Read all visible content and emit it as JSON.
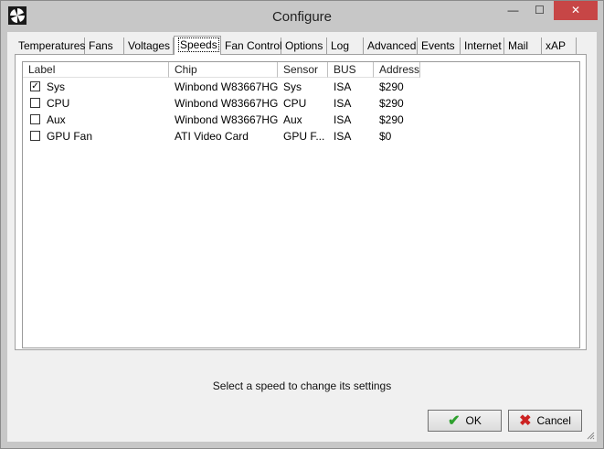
{
  "window": {
    "title": "Configure",
    "controls": {
      "minimize": "—",
      "maximize": "☐",
      "close": "✕"
    }
  },
  "tabs": [
    {
      "label": "Temperatures",
      "active": false
    },
    {
      "label": "Fans",
      "active": false
    },
    {
      "label": "Voltages",
      "active": false
    },
    {
      "label": "Speeds",
      "active": true
    },
    {
      "label": "Fan Control",
      "active": false
    },
    {
      "label": "Options",
      "active": false
    },
    {
      "label": "Log",
      "active": false
    },
    {
      "label": "Advanced",
      "active": false
    },
    {
      "label": "Events",
      "active": false
    },
    {
      "label": "Internet",
      "active": false
    },
    {
      "label": "Mail",
      "active": false
    },
    {
      "label": "xAP",
      "active": false
    }
  ],
  "list": {
    "columns": [
      "Label",
      "Chip",
      "Sensor",
      "BUS",
      "Address"
    ],
    "rows": [
      {
        "checked": true,
        "label": "Sys",
        "chip": "Winbond W83667HG",
        "sensor": "Sys",
        "bus": "ISA",
        "address": "$290"
      },
      {
        "checked": false,
        "label": "CPU",
        "chip": "Winbond W83667HG",
        "sensor": "CPU",
        "bus": "ISA",
        "address": "$290"
      },
      {
        "checked": false,
        "label": "Aux",
        "chip": "Winbond W83667HG",
        "sensor": "Aux",
        "bus": "ISA",
        "address": "$290"
      },
      {
        "checked": false,
        "label": "GPU Fan",
        "chip": "ATI Video Card",
        "sensor": "GPU F...",
        "bus": "ISA",
        "address": "$0"
      }
    ]
  },
  "status_text": "Select a speed to change its settings",
  "buttons": {
    "ok": "OK",
    "cancel": "Cancel"
  },
  "icons": {
    "ok": "check-icon",
    "cancel": "x-icon"
  },
  "colors": {
    "close_button": "#c74646",
    "ok_icon": "#2ea02e",
    "cancel_icon": "#cc2222"
  }
}
